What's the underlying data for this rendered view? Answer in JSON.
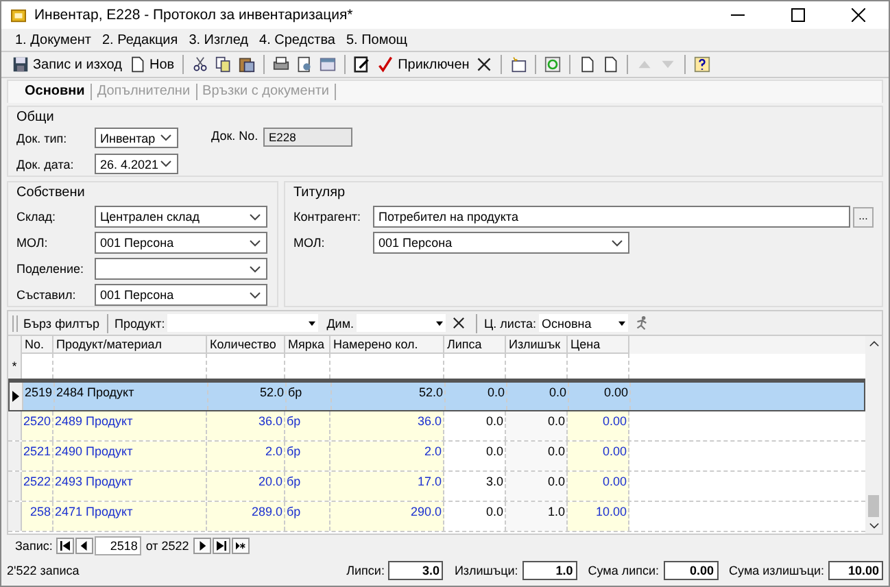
{
  "window": {
    "title": "Инвентар, Е228 - Протокол за инвентаризация*"
  },
  "menu": [
    "1. Документ",
    "2. Редакция",
    "3. Изглед",
    "4. Средства",
    "5. Помощ"
  ],
  "toolbar": [
    {
      "kind": "button",
      "label": "Запис и изход"
    },
    {
      "kind": "button",
      "label": "Нов"
    },
    {
      "kind": "separator"
    },
    {
      "kind": "icon",
      "disabled": false
    },
    {
      "kind": "icon",
      "disabled": false
    },
    {
      "kind": "icon",
      "disabled": false
    },
    {
      "kind": "separator"
    },
    {
      "kind": "icon",
      "disabled": false
    },
    {
      "kind": "icon",
      "disabled": false
    },
    {
      "kind": "icon",
      "disabled": false
    },
    {
      "kind": "separator"
    },
    {
      "kind": "icon",
      "disabled": false
    },
    {
      "kind": "button",
      "label": "Приключен"
    },
    {
      "kind": "icon",
      "disabled": false
    },
    {
      "kind": "separator"
    },
    {
      "kind": "icon",
      "disabled": false
    },
    {
      "kind": "separator"
    },
    {
      "kind": "icon",
      "disabled": false
    },
    {
      "kind": "separator"
    },
    {
      "kind": "icon",
      "disabled": false
    },
    {
      "kind": "icon",
      "disabled": false
    },
    {
      "kind": "separator"
    },
    {
      "kind": "icon",
      "disabled": true
    },
    {
      "kind": "icon",
      "disabled": true
    },
    {
      "kind": "separator"
    },
    {
      "kind": "icon",
      "disabled": false
    }
  ],
  "tabs": [
    {
      "label": "Основни",
      "selected": true
    },
    {
      "label": "Допълнителни",
      "selected": false
    },
    {
      "label": "Връзки с документи",
      "selected": false
    }
  ],
  "general": {
    "title": "Общи",
    "doc_type": {
      "label": "Док. тип:",
      "value": "Инвентар"
    },
    "doc_date": {
      "label": "Док. дата:",
      "value": "26.  4.2021"
    },
    "doc_no": {
      "label": "Док. No.",
      "value": "Е228"
    }
  },
  "own": {
    "title": "Собствени",
    "fields": [
      {
        "label": "Склад:",
        "value": "Централен склад"
      },
      {
        "label": "МОЛ:",
        "value": "001 Персона"
      },
      {
        "label": "Поделение:"
      },
      {
        "label": "Съставил:",
        "value": "001 Персона"
      }
    ]
  },
  "holder": {
    "title": "Титуляр",
    "contractor": {
      "label": "Контрагент:",
      "value": "Потребител на продукта",
      "button": "..."
    },
    "mol": {
      "label": "МОЛ:",
      "value": "001 Персона"
    }
  },
  "quick_filter": {
    "title": "Бърз филтър",
    "product_label": "Продукт:",
    "dim_label": "Дим.",
    "price_list_label": "Ц. листа:",
    "price_list": "Основна"
  },
  "table": {
    "columns": [
      "No.",
      "Продукт/материал",
      "Количество",
      "Мярка",
      "Намерено кол.",
      "Липса",
      "Излишък",
      "Цена"
    ],
    "new_row_marker": "*",
    "rows": [
      {
        "cells": [
          "2519",
          "2484 Продукт",
          "52.0",
          "бр",
          "52.0",
          "0.0",
          "0.0",
          "0.00"
        ],
        "selected": true
      },
      {
        "cells": [
          "2520",
          "2489 Продукт",
          "36.0",
          "бр",
          "36.0",
          "0.0",
          "0.0",
          "0.00"
        ],
        "selected": false
      },
      {
        "cells": [
          "2521",
          "2490 Продукт",
          "2.0",
          "бр",
          "2.0",
          "0.0",
          "0.0",
          "0.00"
        ],
        "selected": false
      },
      {
        "cells": [
          "2522",
          "2493 Продукт",
          "20.0",
          "бр",
          "17.0",
          "3.0",
          "0.0",
          "0.00"
        ],
        "selected": false
      },
      {
        "cells": [
          "258",
          "2471 Продукт",
          "289.0",
          "бр",
          "290.0",
          "0.0",
          "1.0",
          "10.00"
        ],
        "selected": false
      }
    ]
  },
  "navigator": {
    "label": "Запис:",
    "current": "2518",
    "of": "от 2522"
  },
  "status_bar": {
    "count": "2'522 записа",
    "totals": [
      {
        "label": "Липси:",
        "value": "3.0"
      },
      {
        "label": "Излишъци:",
        "value": "1.0"
      },
      {
        "label": "Сума липси:",
        "value": "0.00"
      },
      {
        "label": "Сума излишъци:",
        "value": "10.00"
      }
    ]
  }
}
